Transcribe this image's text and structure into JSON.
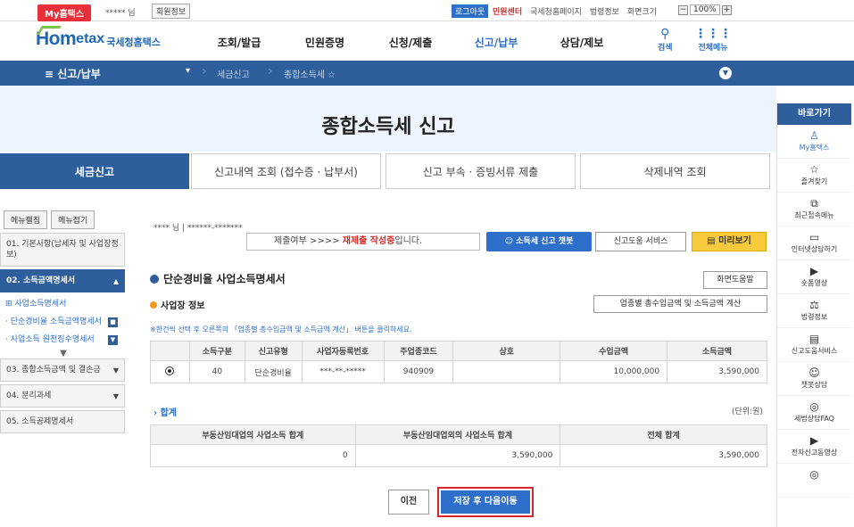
{
  "topbar": {
    "myhometax": "My홈택스",
    "user_masked": "***** 님",
    "member_info": "회원정보",
    "logout": "로그아웃",
    "links": [
      "민원센터",
      "국세청홈페이지",
      "법령정보",
      "화면크기"
    ],
    "zoom_minus": "−",
    "zoom_value": "100%",
    "zoom_plus": "+"
  },
  "logo": {
    "home": "Hom",
    "tax": "etax",
    "sub": "국세청홈택스"
  },
  "mainmenu": {
    "items": [
      "조회/발급",
      "민원증명",
      "신청/제출",
      "신고/납부",
      "상담/제보"
    ],
    "active_index": 3,
    "search_label": "검색",
    "allmenu_label": "전체메뉴"
  },
  "breadcrumb": {
    "section": "≡ 신고/납부",
    "crumb1": "세금신고",
    "crumb2": "종합소득세 ☆"
  },
  "banner": {
    "title": "종합소득세 신고"
  },
  "tabs": [
    "세금신고",
    "신고내역 조회 (접수증 · 납부서)",
    "신고 부속 · 증빙서류 제출",
    "삭제내역 조회"
  ],
  "leftmenu": {
    "expand_all": "메뉴펼침",
    "collapse_all": "메뉴접기",
    "items": [
      {
        "label": "01. 기본사항(납세자 및 사업장정보)"
      },
      {
        "label": "02. 소득금액명세서"
      },
      {
        "label": "03. 종합소득금액 및 결손금"
      },
      {
        "label": "04. 분리과세"
      },
      {
        "label": "05. 소득공제명세서"
      }
    ],
    "sub_header": "⊞ 사업소득명세서",
    "subs": [
      "· 단순경비율 소득금액명세서",
      "· 사업소득 원천징수명세서"
    ],
    "down_arrow": "▼"
  },
  "content": {
    "user_line": "**** 님  |  ******-*******",
    "status_prefix": "제출여부  >>>>  ",
    "status_value": "재제출 작성중",
    "status_suffix": "입니다.",
    "chatbot_btn": "소득세 신고 챗봇",
    "help_service_btn": "신고도움 서비스",
    "preview_btn": "미리보기",
    "form_title": "단순경비율 사업소득명세서",
    "screen_help_btn": "화면도움말",
    "sub_title": "사업장 정보",
    "calc_btn": "업종별 총수입금액 및 소득금액 계산",
    "notice": "※한건씩 선택 후 오른쪽의 「업종별 총수입금액 및 소득금액 계산」 버튼을 클릭하세요.",
    "biz_table": {
      "headers": [
        "소득구분",
        "신고유형",
        "사업자등록번호",
        "주업종코드",
        "상호",
        "수입금액",
        "소득금액"
      ],
      "rows": [
        {
          "selected": true,
          "cells": [
            "40",
            "단순경비율",
            "***-**-*****",
            "940909",
            "",
            "10,000,000",
            "3,590,000"
          ]
        }
      ]
    },
    "sum_label": "› 합계",
    "unit_label": "(단위:원)",
    "sum_table": {
      "headers": [
        "부동산임대업의 사업소득 합계",
        "부동산임대업외의 사업소득 합계",
        "전체 합계"
      ],
      "values": [
        "0",
        "3,590,000",
        "3,590,000"
      ]
    },
    "prev_btn": "이전",
    "save_next_btn": "저장 후 다음이동"
  },
  "quickpanel": {
    "title": "바로가기",
    "items": [
      {
        "icon": "person-icon",
        "glyph": "♙",
        "label": "My홈택스"
      },
      {
        "icon": "star-icon",
        "glyph": "☆",
        "label": "즐겨찾기"
      },
      {
        "icon": "recent-icon",
        "glyph": "⧉",
        "label": "최근접속메뉴"
      },
      {
        "icon": "monitor-icon",
        "glyph": "▭",
        "label": "인터넷상담하기"
      },
      {
        "icon": "play-icon",
        "glyph": "▶",
        "label": "숏폼영상"
      },
      {
        "icon": "scale-icon",
        "glyph": "⚖",
        "label": "법령정보"
      },
      {
        "icon": "book-icon",
        "glyph": "▤",
        "label": "신고도움서비스"
      },
      {
        "icon": "chat-icon",
        "glyph": "☺",
        "label": "챗봇상담"
      },
      {
        "icon": "faq-icon",
        "glyph": "◎",
        "label": "세법상담FAQ"
      },
      {
        "icon": "video-icon",
        "glyph": "▶",
        "label": "전자신고동영상"
      },
      {
        "icon": "more-icon",
        "glyph": "◎",
        "label": ""
      }
    ]
  },
  "colors": {
    "brand_blue": "#2e5f9c",
    "button_blue": "#2e6fcb",
    "highlight_red": "#d9252a",
    "preview_yellow": "#f7c93b"
  }
}
